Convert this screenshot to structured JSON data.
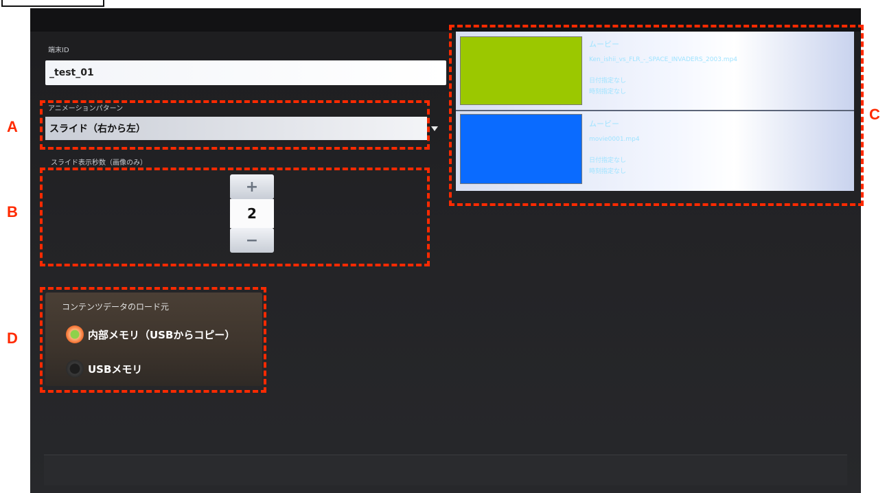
{
  "device": {
    "terminal_id_label": "端末ID",
    "terminal_id_value": "_test_01"
  },
  "animation": {
    "label": "アニメーションパターン",
    "selected": "スライド（右から左）"
  },
  "slide_seconds": {
    "label": "スライド表示秒数（画像のみ）",
    "plus": "+",
    "value": "2",
    "minus": "−"
  },
  "content_list": {
    "items": [
      {
        "type": "ムービー",
        "filename": "Ken_ishii_vs_FLR_-_SPACE_INVADERS_2003.mp4",
        "date_setting": "日付指定なし",
        "time_setting": "時刻指定なし",
        "thumb_color": "#9bc800"
      },
      {
        "type": "ムービー",
        "filename": "movie0001.mp4",
        "date_setting": "日付指定なし",
        "time_setting": "時刻指定なし",
        "thumb_color": "#0a6bff"
      }
    ]
  },
  "load_source": {
    "label": "コンテンツデータのロード元",
    "options": [
      {
        "label": "内部メモリ（USBからコピー）",
        "selected": true
      },
      {
        "label": "USBメモリ",
        "selected": false
      }
    ]
  },
  "callouts": {
    "a": "A",
    "b": "B",
    "c": "C",
    "d": "D",
    "color": "#ff2a00"
  }
}
